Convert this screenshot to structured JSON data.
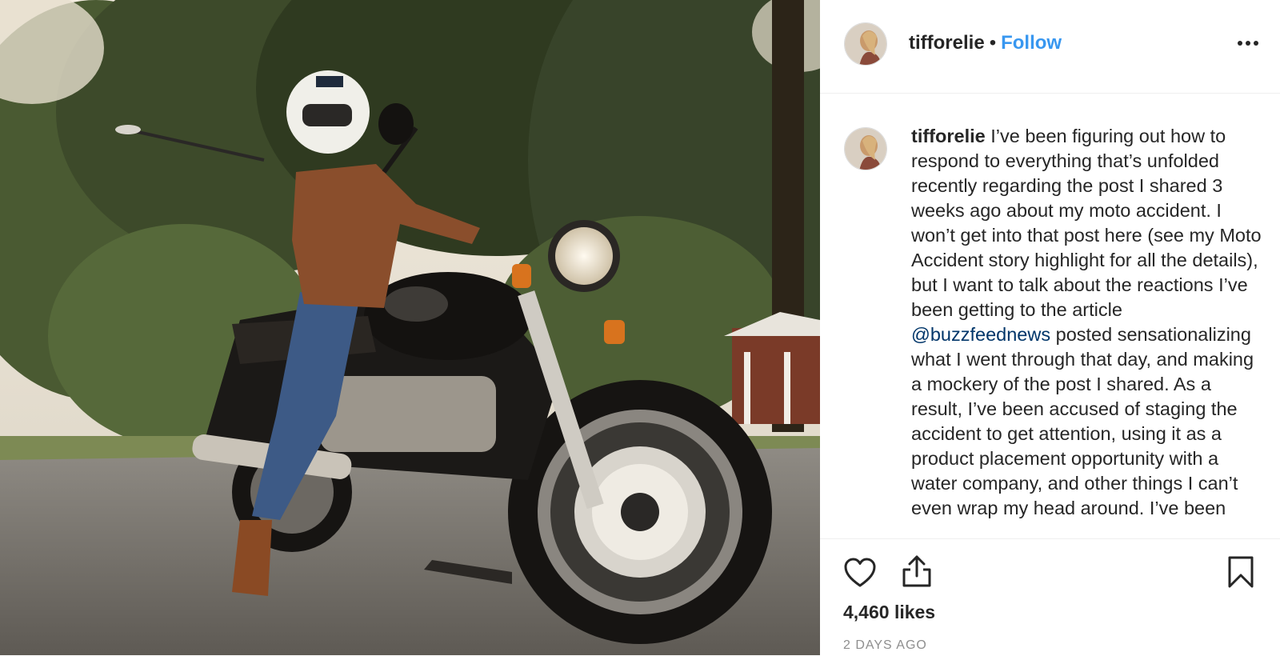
{
  "post": {
    "image_alt": "Woman in helmet and brown leather jacket sitting on a black BMW motorcycle on a tree-lined street",
    "username": "tifforelie",
    "separator": "•",
    "follow_label": "Follow",
    "more_icon": "more-options-icon"
  },
  "caption": {
    "username": "tifforelie",
    "text_before_mention": "I’ve been figuring out how to respond to everything that’s unfolded recently regarding the post I shared 3 weeks ago about my moto accident. I won’t get into that post here (see my Moto Accident story highlight for all the details), but I want to talk about the reactions I’ve been getting to the article",
    "mention": "@buzzfeednews",
    "text_after_mention": "posted sensationalizing what I went through that day, and making a mockery of the post I shared. As a result, I’ve been accused of staging the accident to get attention, using it as a product placement opportunity with a water company, and other things I can’t even wrap my head around. I’ve been"
  },
  "actions": {
    "like_icon": "heart-icon",
    "share_icon": "share-icon",
    "save_icon": "bookmark-icon",
    "likes": "4,460 likes",
    "date": "2 DAYS AGO"
  },
  "colors": {
    "follow": "#3897f0",
    "mention": "#003569",
    "text": "#262626",
    "muted": "#8e8e8e"
  }
}
